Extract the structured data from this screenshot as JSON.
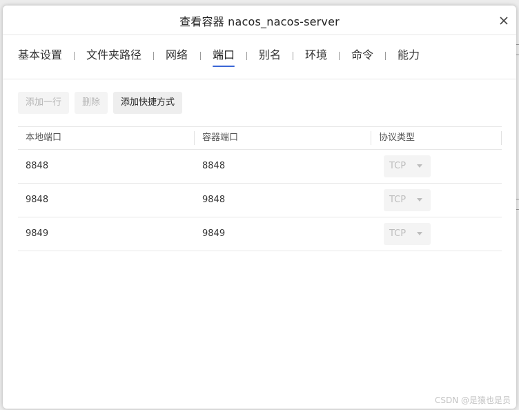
{
  "dialog": {
    "title": "查看容器 nacos_nacos-server"
  },
  "tabs": [
    {
      "label": "基本设置"
    },
    {
      "label": "文件夹路径"
    },
    {
      "label": "网络"
    },
    {
      "label": "端口"
    },
    {
      "label": "别名"
    },
    {
      "label": "环境"
    },
    {
      "label": "命令"
    },
    {
      "label": "能力"
    }
  ],
  "active_tab": "端口",
  "toolbar": {
    "add_row": "添加一行",
    "delete": "删除",
    "add_shortcut": "添加快捷方式"
  },
  "table": {
    "headers": [
      "本地端口",
      "容器端口",
      "协议类型"
    ],
    "rows": [
      {
        "local": "8848",
        "container": "8848",
        "protocol": "TCP"
      },
      {
        "local": "9848",
        "container": "9848",
        "protocol": "TCP"
      },
      {
        "local": "9849",
        "container": "9849",
        "protocol": "TCP"
      }
    ]
  },
  "watermark": "CSDN @是猿也是员",
  "colors": {
    "accent": "#3a66d6",
    "disabled_text": "#b5b5b5",
    "border": "#e7e7e7"
  }
}
